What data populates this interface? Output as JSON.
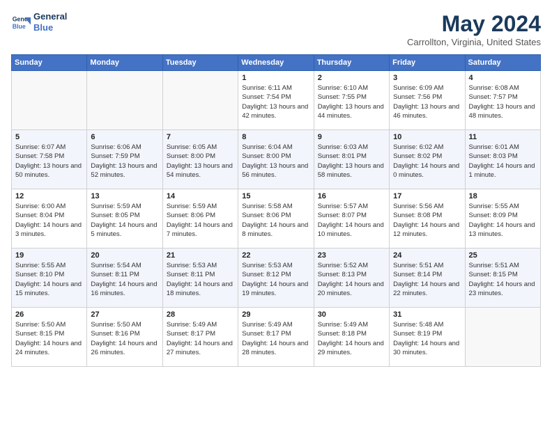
{
  "header": {
    "logo_line1": "General",
    "logo_line2": "Blue",
    "month_title": "May 2024",
    "location": "Carrollton, Virginia, United States"
  },
  "weekdays": [
    "Sunday",
    "Monday",
    "Tuesday",
    "Wednesday",
    "Thursday",
    "Friday",
    "Saturday"
  ],
  "weeks": [
    [
      {
        "day": "",
        "sunrise": "",
        "sunset": "",
        "daylight": ""
      },
      {
        "day": "",
        "sunrise": "",
        "sunset": "",
        "daylight": ""
      },
      {
        "day": "",
        "sunrise": "",
        "sunset": "",
        "daylight": ""
      },
      {
        "day": "1",
        "sunrise": "Sunrise: 6:11 AM",
        "sunset": "Sunset: 7:54 PM",
        "daylight": "Daylight: 13 hours and 42 minutes."
      },
      {
        "day": "2",
        "sunrise": "Sunrise: 6:10 AM",
        "sunset": "Sunset: 7:55 PM",
        "daylight": "Daylight: 13 hours and 44 minutes."
      },
      {
        "day": "3",
        "sunrise": "Sunrise: 6:09 AM",
        "sunset": "Sunset: 7:56 PM",
        "daylight": "Daylight: 13 hours and 46 minutes."
      },
      {
        "day": "4",
        "sunrise": "Sunrise: 6:08 AM",
        "sunset": "Sunset: 7:57 PM",
        "daylight": "Daylight: 13 hours and 48 minutes."
      }
    ],
    [
      {
        "day": "5",
        "sunrise": "Sunrise: 6:07 AM",
        "sunset": "Sunset: 7:58 PM",
        "daylight": "Daylight: 13 hours and 50 minutes."
      },
      {
        "day": "6",
        "sunrise": "Sunrise: 6:06 AM",
        "sunset": "Sunset: 7:59 PM",
        "daylight": "Daylight: 13 hours and 52 minutes."
      },
      {
        "day": "7",
        "sunrise": "Sunrise: 6:05 AM",
        "sunset": "Sunset: 8:00 PM",
        "daylight": "Daylight: 13 hours and 54 minutes."
      },
      {
        "day": "8",
        "sunrise": "Sunrise: 6:04 AM",
        "sunset": "Sunset: 8:00 PM",
        "daylight": "Daylight: 13 hours and 56 minutes."
      },
      {
        "day": "9",
        "sunrise": "Sunrise: 6:03 AM",
        "sunset": "Sunset: 8:01 PM",
        "daylight": "Daylight: 13 hours and 58 minutes."
      },
      {
        "day": "10",
        "sunrise": "Sunrise: 6:02 AM",
        "sunset": "Sunset: 8:02 PM",
        "daylight": "Daylight: 14 hours and 0 minutes."
      },
      {
        "day": "11",
        "sunrise": "Sunrise: 6:01 AM",
        "sunset": "Sunset: 8:03 PM",
        "daylight": "Daylight: 14 hours and 1 minute."
      }
    ],
    [
      {
        "day": "12",
        "sunrise": "Sunrise: 6:00 AM",
        "sunset": "Sunset: 8:04 PM",
        "daylight": "Daylight: 14 hours and 3 minutes."
      },
      {
        "day": "13",
        "sunrise": "Sunrise: 5:59 AM",
        "sunset": "Sunset: 8:05 PM",
        "daylight": "Daylight: 14 hours and 5 minutes."
      },
      {
        "day": "14",
        "sunrise": "Sunrise: 5:59 AM",
        "sunset": "Sunset: 8:06 PM",
        "daylight": "Daylight: 14 hours and 7 minutes."
      },
      {
        "day": "15",
        "sunrise": "Sunrise: 5:58 AM",
        "sunset": "Sunset: 8:06 PM",
        "daylight": "Daylight: 14 hours and 8 minutes."
      },
      {
        "day": "16",
        "sunrise": "Sunrise: 5:57 AM",
        "sunset": "Sunset: 8:07 PM",
        "daylight": "Daylight: 14 hours and 10 minutes."
      },
      {
        "day": "17",
        "sunrise": "Sunrise: 5:56 AM",
        "sunset": "Sunset: 8:08 PM",
        "daylight": "Daylight: 14 hours and 12 minutes."
      },
      {
        "day": "18",
        "sunrise": "Sunrise: 5:55 AM",
        "sunset": "Sunset: 8:09 PM",
        "daylight": "Daylight: 14 hours and 13 minutes."
      }
    ],
    [
      {
        "day": "19",
        "sunrise": "Sunrise: 5:55 AM",
        "sunset": "Sunset: 8:10 PM",
        "daylight": "Daylight: 14 hours and 15 minutes."
      },
      {
        "day": "20",
        "sunrise": "Sunrise: 5:54 AM",
        "sunset": "Sunset: 8:11 PM",
        "daylight": "Daylight: 14 hours and 16 minutes."
      },
      {
        "day": "21",
        "sunrise": "Sunrise: 5:53 AM",
        "sunset": "Sunset: 8:11 PM",
        "daylight": "Daylight: 14 hours and 18 minutes."
      },
      {
        "day": "22",
        "sunrise": "Sunrise: 5:53 AM",
        "sunset": "Sunset: 8:12 PM",
        "daylight": "Daylight: 14 hours and 19 minutes."
      },
      {
        "day": "23",
        "sunrise": "Sunrise: 5:52 AM",
        "sunset": "Sunset: 8:13 PM",
        "daylight": "Daylight: 14 hours and 20 minutes."
      },
      {
        "day": "24",
        "sunrise": "Sunrise: 5:51 AM",
        "sunset": "Sunset: 8:14 PM",
        "daylight": "Daylight: 14 hours and 22 minutes."
      },
      {
        "day": "25",
        "sunrise": "Sunrise: 5:51 AM",
        "sunset": "Sunset: 8:15 PM",
        "daylight": "Daylight: 14 hours and 23 minutes."
      }
    ],
    [
      {
        "day": "26",
        "sunrise": "Sunrise: 5:50 AM",
        "sunset": "Sunset: 8:15 PM",
        "daylight": "Daylight: 14 hours and 24 minutes."
      },
      {
        "day": "27",
        "sunrise": "Sunrise: 5:50 AM",
        "sunset": "Sunset: 8:16 PM",
        "daylight": "Daylight: 14 hours and 26 minutes."
      },
      {
        "day": "28",
        "sunrise": "Sunrise: 5:49 AM",
        "sunset": "Sunset: 8:17 PM",
        "daylight": "Daylight: 14 hours and 27 minutes."
      },
      {
        "day": "29",
        "sunrise": "Sunrise: 5:49 AM",
        "sunset": "Sunset: 8:17 PM",
        "daylight": "Daylight: 14 hours and 28 minutes."
      },
      {
        "day": "30",
        "sunrise": "Sunrise: 5:49 AM",
        "sunset": "Sunset: 8:18 PM",
        "daylight": "Daylight: 14 hours and 29 minutes."
      },
      {
        "day": "31",
        "sunrise": "Sunrise: 5:48 AM",
        "sunset": "Sunset: 8:19 PM",
        "daylight": "Daylight: 14 hours and 30 minutes."
      },
      {
        "day": "",
        "sunrise": "",
        "sunset": "",
        "daylight": ""
      }
    ]
  ]
}
